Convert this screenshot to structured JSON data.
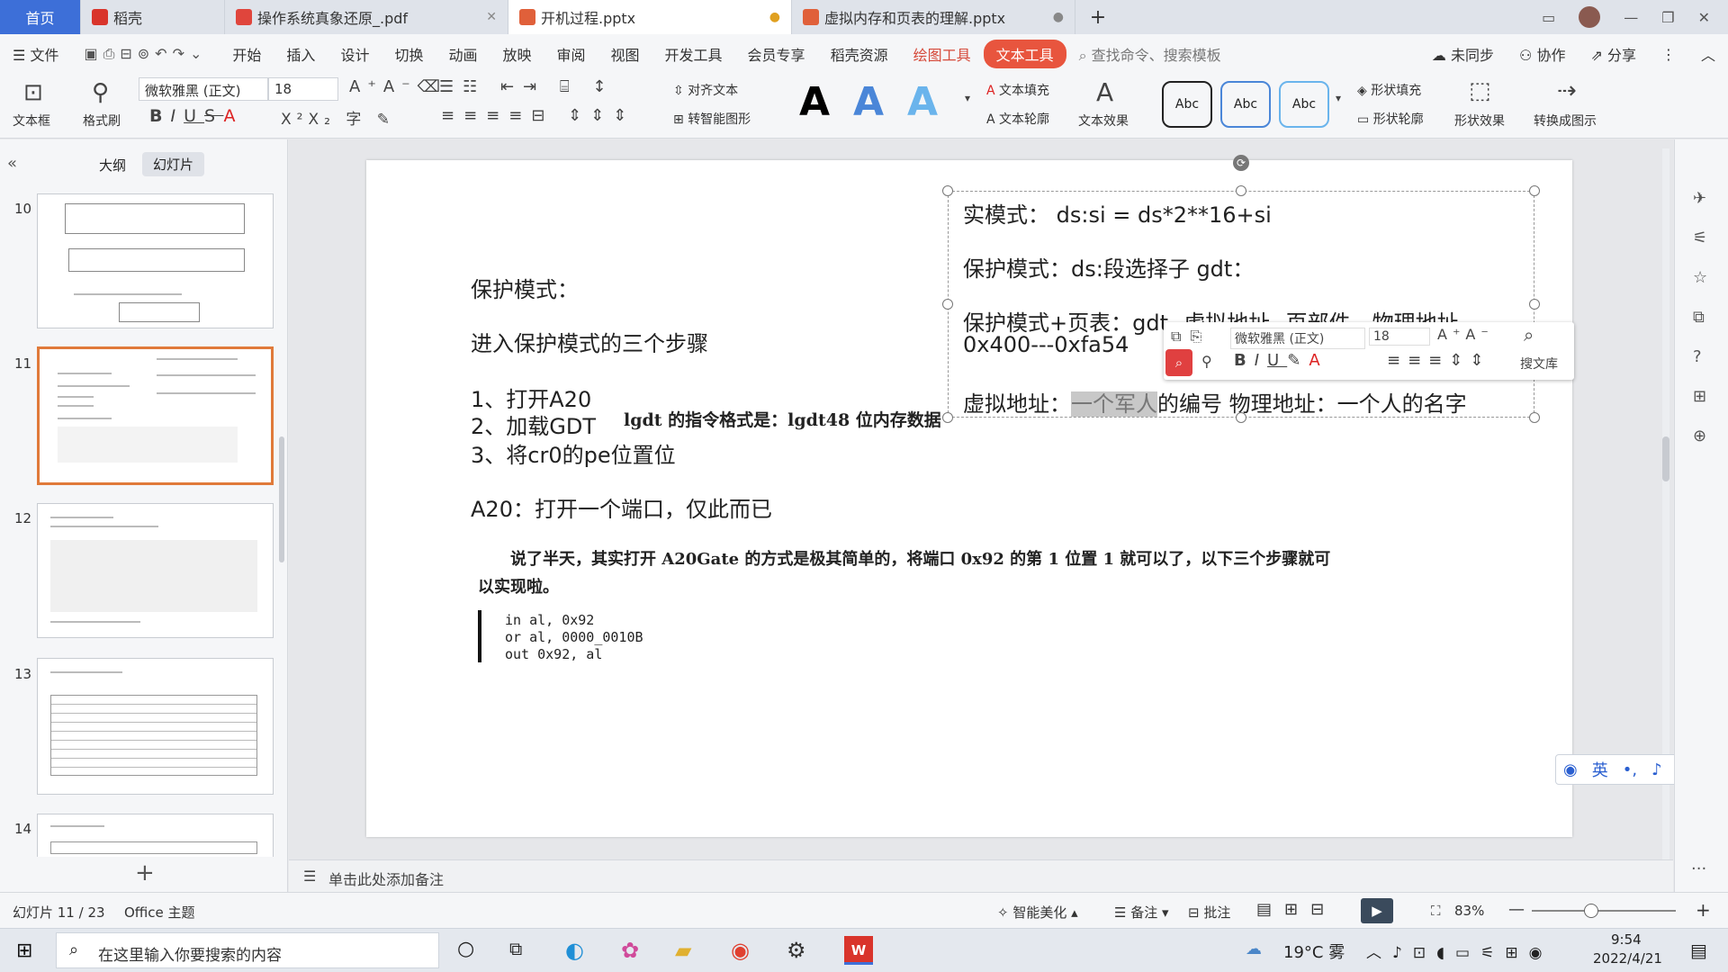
{
  "tabs": [
    {
      "label": "首页",
      "icon": "home"
    },
    {
      "label": "稻壳",
      "icon": "docer-icon"
    },
    {
      "label": "操作系统真象还原_.pdf",
      "icon": "pdf-icon"
    },
    {
      "label": "开机过程.pptx",
      "icon": "ppt-icon"
    },
    {
      "label": "虚拟内存和页表的理解.pptx",
      "icon": "ppt-icon"
    }
  ],
  "menubar": {
    "file": "文件",
    "items": [
      "开始",
      "插入",
      "设计",
      "切换",
      "动画",
      "放映",
      "审阅",
      "视图",
      "开发工具",
      "会员专享",
      "稻壳资源"
    ],
    "draw_tools": "绘图工具",
    "text_tools": "文本工具",
    "search_placeholder": "查找命令、搜索模板",
    "sync": "未同步",
    "collab": "协作",
    "share": "分享"
  },
  "ribbon": {
    "textbox": "文本框",
    "format_painter": "格式刷",
    "font_name": "微软雅黑 (正文)",
    "font_size": "18",
    "align_text": "对齐文本",
    "smart_shape": "转智能图形",
    "text_fill": "文本填充",
    "text_outline": "文本轮廓",
    "text_effect": "文本效果",
    "style_abc": "Abc",
    "shape_fill": "形状填充",
    "shape_outline": "形状轮廓",
    "shape_effect": "形状效果",
    "convert_to_image": "转换成图示"
  },
  "leftpanel": {
    "tab_outline": "大纲",
    "tab_slides": "幻灯片",
    "slides": [
      "10",
      "11",
      "12",
      "13",
      "14"
    ],
    "add": "+"
  },
  "slide": {
    "left_lines": [
      "保护模式：",
      "进入保护模式的三个步骤",
      "1、打开A20",
      "2、加载GDT",
      "3、将cr0的pe位置位",
      "A20：打开一个端口，仅此而已"
    ],
    "lgdt_note": "lgdt 的指令格式是：lgdt48 位内存数据",
    "right_lines": [
      "实模式： ds:si = ds*2**16+si",
      "保护模式：ds:段选择子 gdt：",
      "保护模式+页表：gdt--虚拟地址--页部件—物理地址",
      "0x400---0xfa54"
    ],
    "virtual_prefix": "虚拟地址：",
    "virtual_selected": "一个军人",
    "virtual_suffix": "的编号  物理地址：一个人的名字",
    "image_para": "说了半天，其实打开 A20Gate 的方式是极其简单的，将端口 0x92 的第 1 位置 1 就可以了，以下三个步骤就可以实现啦。",
    "code_lines": [
      "in al, 0x92",
      "or al, 0000_0010B",
      "out 0x92, al"
    ]
  },
  "floatbar": {
    "font": "微软雅黑 (正文)",
    "size": "18",
    "library": "搜文库"
  },
  "notes_placeholder": "单击此处添加备注",
  "status": {
    "slide_pos": "幻灯片 11 / 23",
    "theme": "Office 主题",
    "beautify": "智能美化",
    "notes": "备注",
    "comment": "批注",
    "zoom": "83%"
  },
  "ime": {
    "lang": "英"
  },
  "taskbar": {
    "search_placeholder": "在这里输入你要搜索的内容",
    "weather": "19°C 雾",
    "time": "9:54",
    "date": "2022/4/21"
  }
}
